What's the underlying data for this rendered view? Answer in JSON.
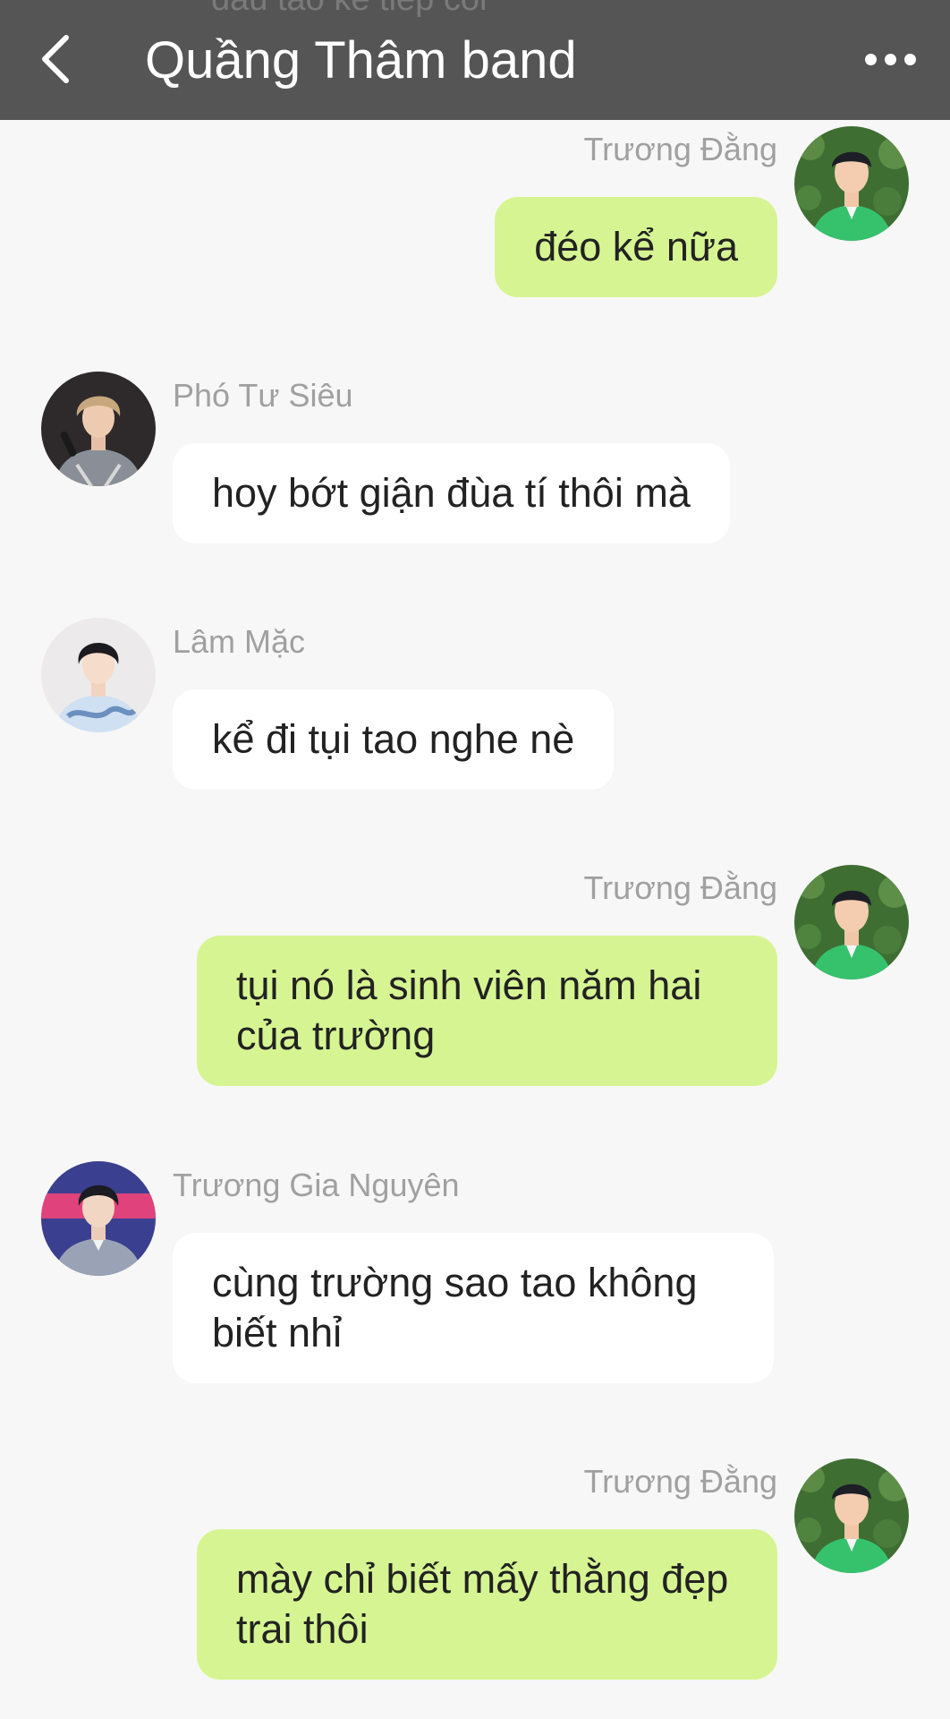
{
  "header": {
    "title": "Quầng Thâm band",
    "behind_text": "đầu tao kể tiếp coi"
  },
  "messages": [
    {
      "sender": "Trương Đằng",
      "text": "đéo kể nữa",
      "own": true
    },
    {
      "sender": "Phó Tư Siêu",
      "text": "hoy bớt giận đùa tí thôi mà",
      "own": false
    },
    {
      "sender": "Lâm Mặc",
      "text": "kể đi tụi tao nghe nè",
      "own": false
    },
    {
      "sender": "Trương Đằng",
      "text": "tụi nó là sinh viên năm hai của trường",
      "own": true
    },
    {
      "sender": "Trương Gia Nguyên",
      "text": "cùng trường sao tao không biết nhỉ",
      "own": false
    },
    {
      "sender": "Trương Đằng",
      "text": "mày chỉ biết mấy thằng đẹp trai thôi",
      "own": true
    }
  ],
  "colors": {
    "header_bg": "#555555",
    "own_bubble": "#d6f592",
    "other_bubble": "#ffffff",
    "background": "#f7f7f7"
  },
  "icons": [
    "back-arrow-icon",
    "more-options-icon"
  ]
}
